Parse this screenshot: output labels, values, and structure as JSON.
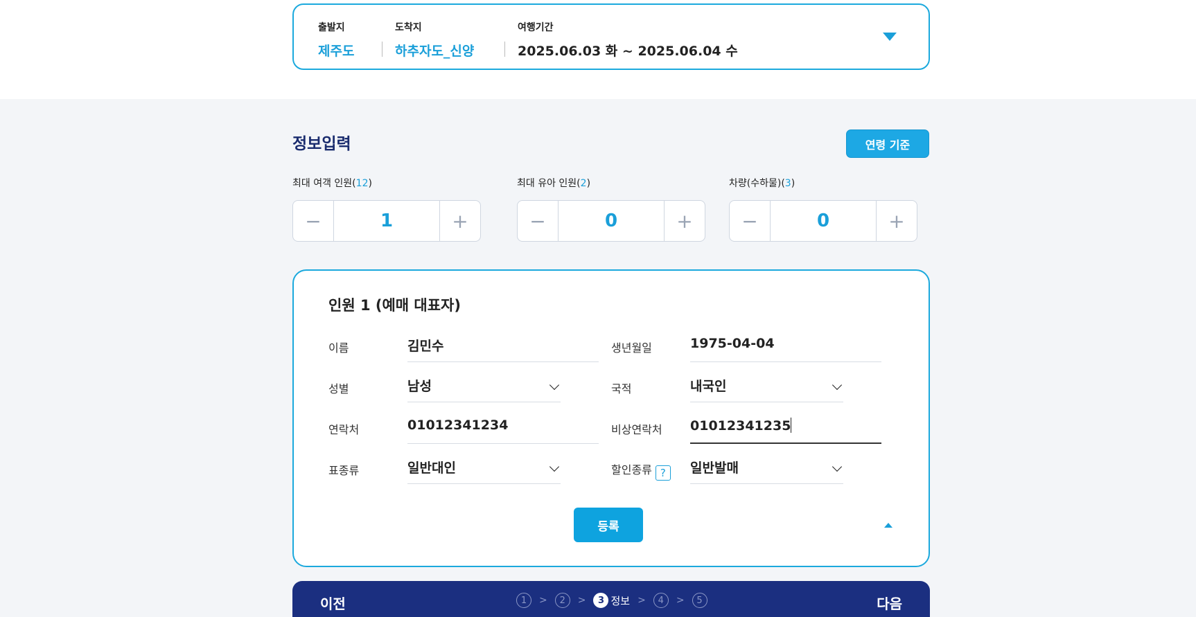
{
  "trip": {
    "departure_label": "출발지",
    "departure_value": "제주도",
    "arrival_label": "도착지",
    "arrival_value": "하추자도_신양",
    "period_label": "여행기간",
    "period_value": "2025.06.03 화 ~ 2025.06.04 수"
  },
  "section": {
    "title": "정보입력",
    "age_button": "연령 기준"
  },
  "counters": [
    {
      "label": "최대 여객 인원(",
      "max": "12",
      "close": ")",
      "value": "1",
      "minus": "−",
      "plus": "+"
    },
    {
      "label": "최대 유아 인원(",
      "max": "2",
      "close": ")",
      "value": "0",
      "minus": "−",
      "plus": "+"
    },
    {
      "label": "차량(수하물)(",
      "max": "3",
      "close": ")",
      "value": "0",
      "minus": "−",
      "plus": "+"
    }
  ],
  "person": {
    "title": "인원 1 (예매 대표자)",
    "name_label": "이름",
    "name_value": "김민수",
    "birth_label": "생년월일",
    "birth_value": "1975-04-04",
    "gender_label": "성별",
    "gender_value": "남성",
    "nationality_label": "국적",
    "nationality_value": "내국인",
    "phone_label": "연락처",
    "phone_value": "01012341234",
    "emergency_label": "비상연락처",
    "emergency_value": "01012341235",
    "ticket_label": "표종류",
    "ticket_value": "일반대인",
    "discount_label": "할인종류",
    "discount_help": "?",
    "discount_value": "일반발매",
    "register_button": "등록"
  },
  "footer": {
    "prev": "이전",
    "next": "다음",
    "steps": [
      {
        "num": "1",
        "label": ""
      },
      {
        "num": "2",
        "label": ""
      },
      {
        "num": "3",
        "label": "정보"
      },
      {
        "num": "4",
        "label": ""
      },
      {
        "num": "5",
        "label": ""
      }
    ],
    "current_step": 3,
    "separator": ">"
  },
  "colors": {
    "accent": "#1a9fd9",
    "navy": "#1b2f80",
    "title_navy": "#1a2c6e",
    "background": "#f3f5f8"
  }
}
